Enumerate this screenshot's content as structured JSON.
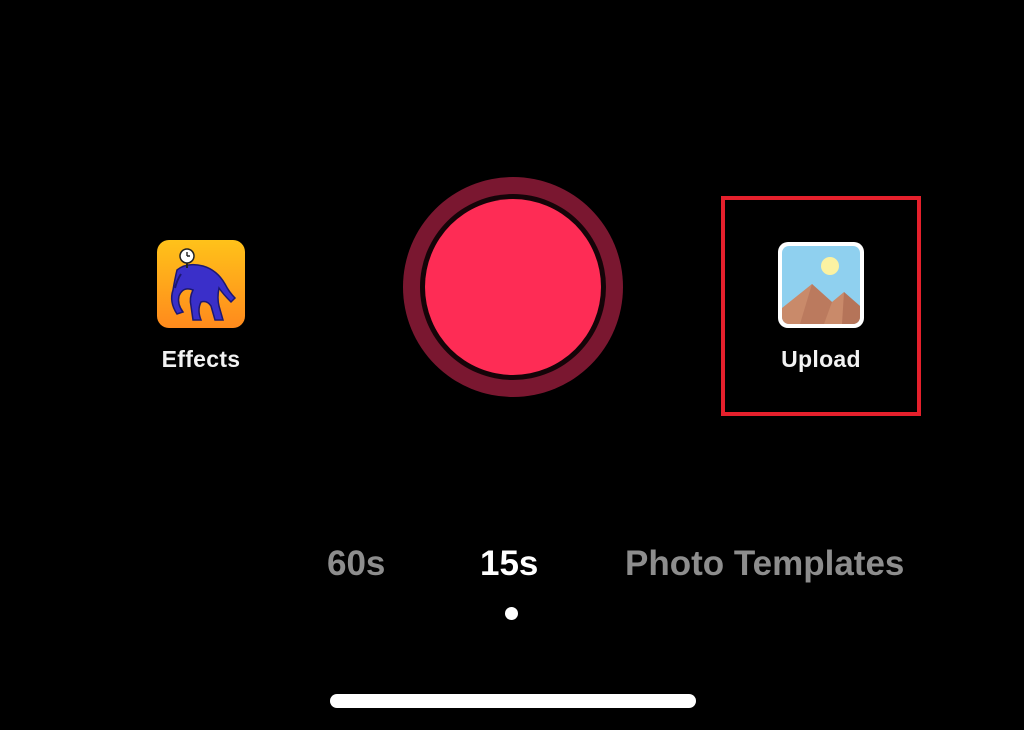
{
  "controls": {
    "effects_label": "Effects",
    "upload_label": "Upload"
  },
  "modes": [
    {
      "label": "60s",
      "selected": false
    },
    {
      "label": "15s",
      "selected": true
    },
    {
      "label": "Photo Templates",
      "selected": false
    }
  ],
  "icons": {
    "effects": "effects-character-icon",
    "upload": "gallery-landscape-icon",
    "record": "record-button"
  },
  "colors": {
    "record_fill": "#fe2c55",
    "record_outer": "#7a1730",
    "highlight": "#e5202c",
    "inactive_mode": "#8d8d8d"
  }
}
